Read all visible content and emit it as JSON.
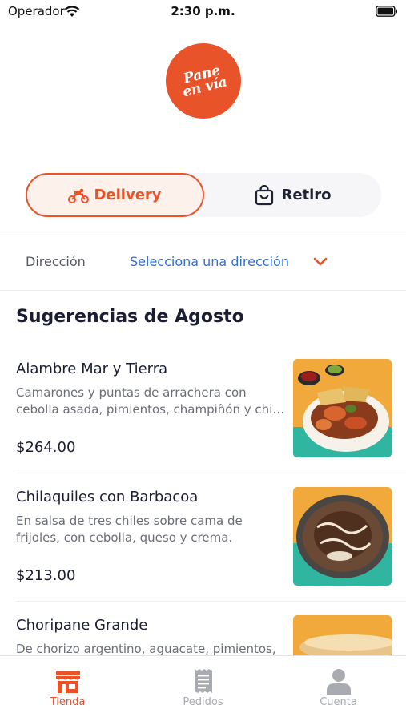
{
  "status_bar": {
    "carrier": "Operador",
    "time": "2:30 p.m."
  },
  "logo": {
    "line1": "Pane",
    "line2": "en vía",
    "color": "#e8532a"
  },
  "order_mode": {
    "delivery_label": "Delivery",
    "pickup_label": "Retiro",
    "selected": "Delivery",
    "accent": "#e8532a"
  },
  "address": {
    "label": "Dirección",
    "value": "Selecciona una dirección",
    "value_color": "#2f6fd6"
  },
  "suggestions": {
    "title": "Sugerencias de Agosto",
    "items": [
      {
        "name": "Alambre Mar y Tierra",
        "desc_line1": "Camarones y puntas de arrachera con",
        "desc_line2": "cebolla asada, pimientos, champiñón y chi…",
        "price": "$264.00"
      },
      {
        "name": "Chilaquiles con Barbacoa",
        "desc_line1": "En salsa de tres chiles sobre cama de",
        "desc_line2": "frijoles, con cebolla, queso y crema.",
        "price": "$213.00"
      },
      {
        "name": "Choripane Grande",
        "desc_line1": "De chorizo argentino, aguacate, pimientos,",
        "desc_line2": "",
        "price": ""
      }
    ]
  },
  "tab_bar": {
    "tabs": [
      {
        "label": "Tienda",
        "icon": "store-icon",
        "active": true
      },
      {
        "label": "Pedidos",
        "icon": "receipt-icon",
        "active": false
      },
      {
        "label": "Cuenta",
        "icon": "user-icon",
        "active": false
      }
    ],
    "active_color": "#e8532a",
    "inactive_color": "#a9abb2"
  }
}
